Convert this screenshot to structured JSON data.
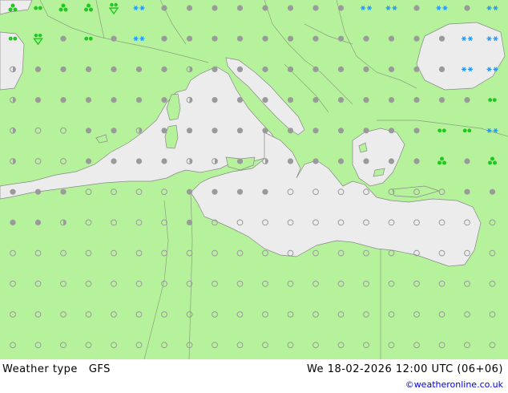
{
  "title": {
    "product": "Weather type",
    "model": "GFS",
    "datetime": "We 18-02-2026 12:00 UTC (06+06)"
  },
  "credit": "©weatheronline.co.uk",
  "colors": {
    "land": "#b6f29c",
    "sea": "#ececec",
    "border": "#8aa080",
    "coast": "#888888",
    "dot_gray": "#9a9a9a",
    "symbol_green": "#1ec81e",
    "symbol_blue": "#1e96ff",
    "symbol_red": "#e03020"
  },
  "map": {
    "region": "Mediterranean",
    "legend_icons": {
      "g": "gray-dot",
      "h": "half-dot",
      "o": "open-circle",
      "d": "drizzle-drops",
      "s": "showers-clover",
      "S": "shower-rain-triangle",
      "r": "light-rain-pair",
      "n": "snow-flakes",
      "N": "snow-clover",
      "m": "mist-tilde"
    },
    "grid_rows": [
      "sdssSnggggggggnngngnnnm",
      "dSgdgnggggggggggggnnnnrr",
      "hgggggghggggggggggnnsssg",
      "hgggggghgggggggggggrnrrr",
      "hoogghgggggggggggddnddnd",
      "hoogggghhghggggggsgsddnnS",
      "gggooooggggoooooooggSSSSg",
      "gghoooogoooooooooooooSSS",
      "ooooooooooooooooooooooo",
      "ooooooooooooooooooooooo",
      "ooooooooooooooooooooooo",
      "ooooooooooooooooooooooo"
    ]
  }
}
